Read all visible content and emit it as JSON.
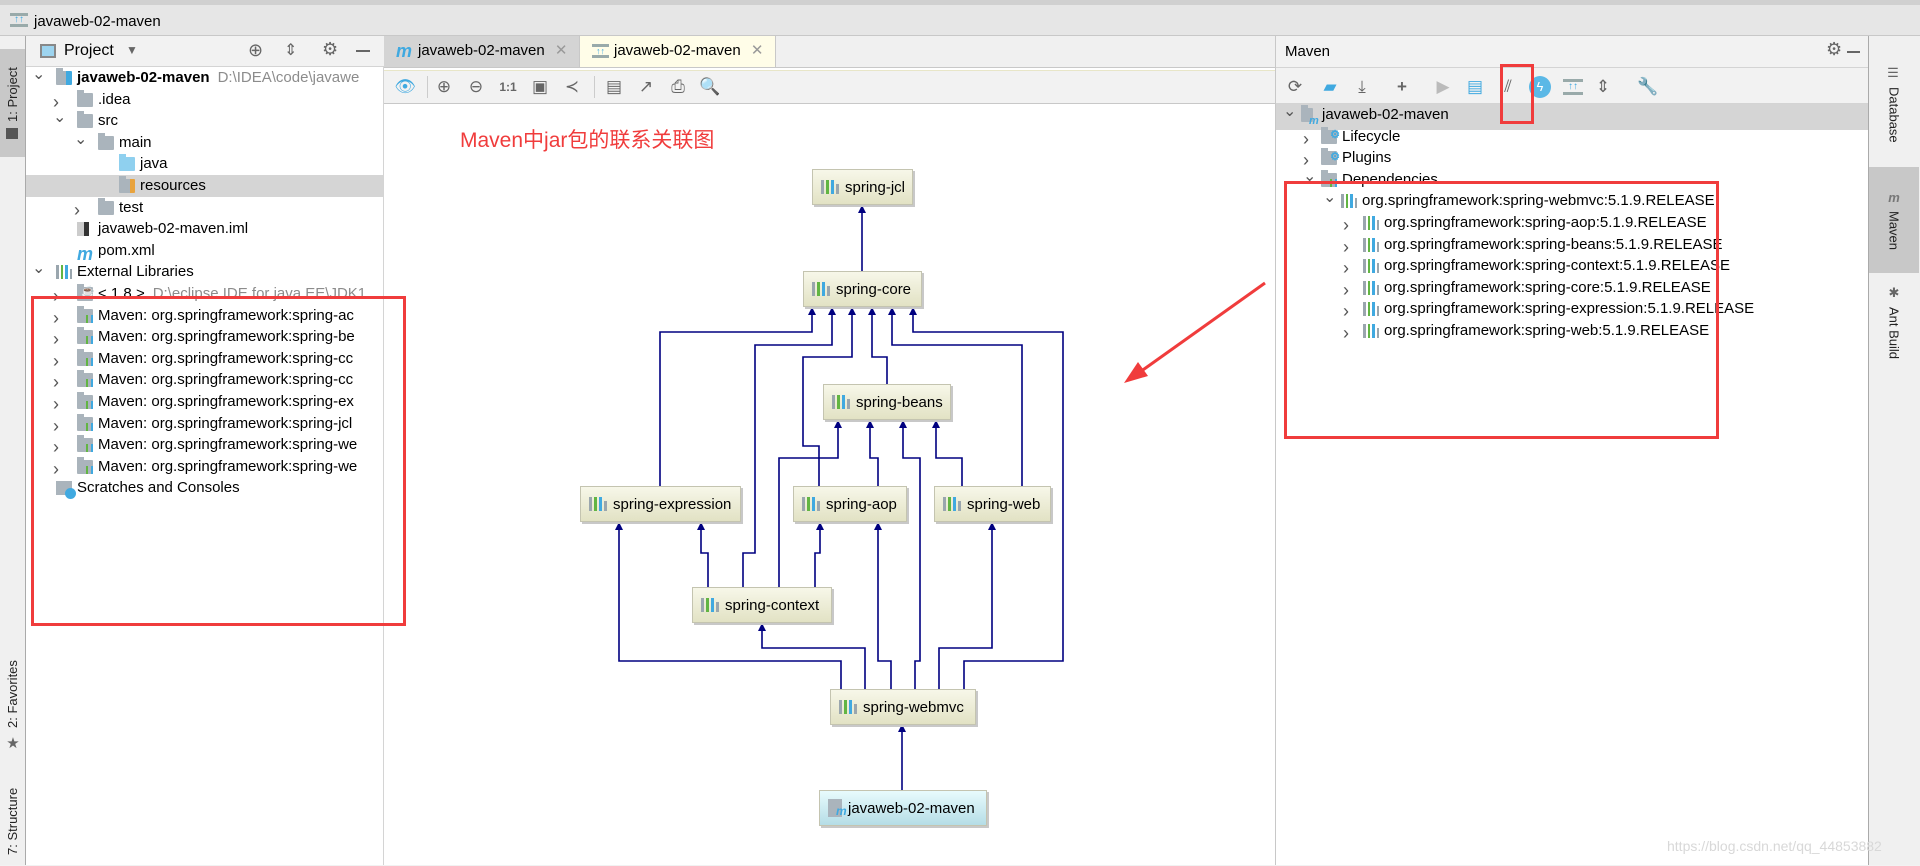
{
  "window": {
    "title": "javaweb-02-maven"
  },
  "left_strip": {
    "tabs": [
      {
        "label": "1: Project",
        "active": true
      },
      {
        "label": "2: Favorites"
      },
      {
        "label": "7: Structure"
      }
    ]
  },
  "project_panel": {
    "title": "Project",
    "tree": [
      {
        "label": "javaweb-02-maven",
        "hint": "D:\\IDEA\\code\\javawe",
        "level": 0,
        "chev": "down",
        "icon": "module",
        "bold": true
      },
      {
        "label": ".idea",
        "level": 1,
        "chev": "right",
        "icon": "folder"
      },
      {
        "label": "src",
        "level": 1,
        "chev": "down",
        "icon": "folder"
      },
      {
        "label": "main",
        "level": 2,
        "chev": "down",
        "icon": "folder"
      },
      {
        "label": "java",
        "level": 3,
        "icon": "folder-blue"
      },
      {
        "label": "resources",
        "level": 3,
        "icon": "folder-resources",
        "selected": true
      },
      {
        "label": "test",
        "level": 2,
        "chev": "right",
        "icon": "folder"
      },
      {
        "label": "javaweb-02-maven.iml",
        "level": 1,
        "icon": "iml-file"
      },
      {
        "label": "pom.xml",
        "level": 1,
        "icon": "maven-file"
      },
      {
        "label": "External Libraries",
        "level": 0,
        "chev": "down",
        "icon": "library"
      },
      {
        "label": "< 1.8 >",
        "hint": "D:\\eclipse IDE for java EE\\JDK1.",
        "level": 1,
        "chev": "right",
        "icon": "jdk"
      },
      {
        "label": "Maven: org.springframework:spring-ac",
        "level": 1,
        "chev": "right",
        "icon": "lib-folder"
      },
      {
        "label": "Maven: org.springframework:spring-be",
        "level": 1,
        "chev": "right",
        "icon": "lib-folder"
      },
      {
        "label": "Maven: org.springframework:spring-cc",
        "level": 1,
        "chev": "right",
        "icon": "lib-folder"
      },
      {
        "label": "Maven: org.springframework:spring-cc",
        "level": 1,
        "chev": "right",
        "icon": "lib-folder"
      },
      {
        "label": "Maven: org.springframework:spring-ex",
        "level": 1,
        "chev": "right",
        "icon": "lib-folder"
      },
      {
        "label": "Maven: org.springframework:spring-jcl",
        "level": 1,
        "chev": "right",
        "icon": "lib-folder"
      },
      {
        "label": "Maven: org.springframework:spring-we",
        "level": 1,
        "chev": "right",
        "icon": "lib-folder"
      },
      {
        "label": "Maven: org.springframework:spring-we",
        "level": 1,
        "chev": "right",
        "icon": "lib-folder"
      },
      {
        "label": "Scratches and Consoles",
        "level": 0,
        "icon": "scratches"
      }
    ]
  },
  "editor": {
    "tabs": [
      {
        "label": "javaweb-02-maven",
        "icon": "maven-m-icon",
        "active": false
      },
      {
        "label": "javaweb-02-maven",
        "icon": "diagram-icon",
        "active": true
      }
    ],
    "toolbar": [
      "eye-icon",
      "zoom-in-icon",
      "zoom-out-icon",
      "actual-size-icon",
      "fit-content-icon",
      "layout-icon",
      "save-icon",
      "export-icon",
      "print-icon",
      "find-icon"
    ],
    "toolbar_actual_size": "1:1",
    "annotation": "Maven中jar包的联系关联图",
    "diagram": {
      "nodes": [
        "spring-jcl",
        "spring-core",
        "spring-beans",
        "spring-expression",
        "spring-aop",
        "spring-web",
        "spring-context",
        "spring-webmvc",
        "javaweb-02-maven"
      ],
      "edges": [
        [
          "spring-core",
          "spring-jcl"
        ],
        [
          "spring-expression",
          "spring-core"
        ],
        [
          "spring-context",
          "spring-core"
        ],
        [
          "spring-aop",
          "spring-core"
        ],
        [
          "spring-beans",
          "spring-core"
        ],
        [
          "spring-web",
          "spring-core"
        ],
        [
          "spring-webmvc",
          "spring-core"
        ],
        [
          "spring-context",
          "spring-beans"
        ],
        [
          "spring-aop",
          "spring-beans"
        ],
        [
          "spring-webmvc",
          "spring-beans"
        ],
        [
          "spring-web",
          "spring-beans"
        ],
        [
          "spring-webmvc",
          "spring-expression"
        ],
        [
          "spring-context",
          "spring-expression"
        ],
        [
          "spring-context",
          "spring-aop"
        ],
        [
          "spring-webmvc",
          "spring-aop"
        ],
        [
          "spring-webmvc",
          "spring-web"
        ],
        [
          "spring-webmvc",
          "spring-context"
        ],
        [
          "javaweb-02-maven",
          "spring-webmvc"
        ]
      ]
    }
  },
  "maven_panel": {
    "title": "Maven",
    "toolbar": [
      "reimport-icon",
      "generate-sources-icon",
      "download-icon",
      "add-icon",
      "run-icon",
      "execute-goal-icon",
      "toggle-offline-icon",
      "skip-tests-icon",
      "show-dependencies-icon",
      "collapse-all-icon",
      "settings-wrench-icon"
    ],
    "tree": [
      {
        "label": "javaweb-02-maven",
        "level": 0,
        "chev": "down",
        "icon": "maven-module",
        "selected": true
      },
      {
        "label": "Lifecycle",
        "level": 1,
        "chev": "right",
        "icon": "gear-folder"
      },
      {
        "label": "Plugins",
        "level": 1,
        "chev": "right",
        "icon": "gear-folder"
      },
      {
        "label": "Dependencies",
        "level": 1,
        "chev": "down",
        "icon": "lib-folder"
      },
      {
        "label": "org.springframework:spring-webmvc:5.1.9.RELEASE",
        "level": 2,
        "chev": "down",
        "icon": "library"
      },
      {
        "label": "org.springframework:spring-aop:5.1.9.RELEASE",
        "level": 3,
        "chev": "right",
        "icon": "library"
      },
      {
        "label": "org.springframework:spring-beans:5.1.9.RELEASE",
        "level": 3,
        "chev": "right",
        "icon": "library"
      },
      {
        "label": "org.springframework:spring-context:5.1.9.RELEASE",
        "level": 3,
        "chev": "right",
        "icon": "library"
      },
      {
        "label": "org.springframework:spring-core:5.1.9.RELEASE",
        "level": 3,
        "chev": "right",
        "icon": "library"
      },
      {
        "label": "org.springframework:spring-expression:5.1.9.RELEASE",
        "level": 3,
        "chev": "right",
        "icon": "library"
      },
      {
        "label": "org.springframework:spring-web:5.1.9.RELEASE",
        "level": 3,
        "chev": "right",
        "icon": "library"
      }
    ]
  },
  "right_strip": {
    "tabs": [
      {
        "label": "Database"
      },
      {
        "label": "Maven",
        "active": true
      },
      {
        "label": "Ant Build"
      }
    ]
  },
  "watermark": "https://blog.csdn.net/qq_44853882",
  "colors": {
    "annotation_red": "#f03c3c",
    "edge": "#000080",
    "selection": "#d5d5d5"
  }
}
